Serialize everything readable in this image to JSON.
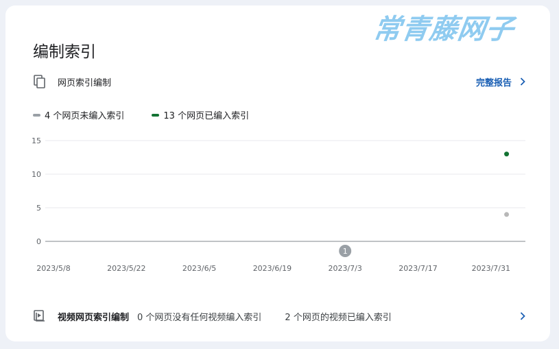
{
  "watermark": "常青藤网子",
  "card": {
    "title": "编制索引"
  },
  "pages_row": {
    "icon": "copy-pages-icon",
    "label": "网页索引编制",
    "report_label": "完整报告"
  },
  "legend": [
    {
      "label": "4 个网页未编入索引",
      "color": "#9aa0a6"
    },
    {
      "label": "13 个网页已编入索引",
      "color": "#137333"
    }
  ],
  "chart_data": {
    "type": "scatter",
    "x_ticks": [
      "2023/5/8",
      "2023/5/22",
      "2023/6/5",
      "2023/6/19",
      "2023/7/3",
      "2023/7/17",
      "2023/7/31"
    ],
    "y_ticks": [
      0,
      5,
      10,
      15
    ],
    "ylim": [
      0,
      15
    ],
    "grid": true,
    "series": [
      {
        "name": "4 个网页未编入索引",
        "color": "#b8b8b8",
        "points": [
          {
            "x": "2023/8/3",
            "y": 4
          }
        ]
      },
      {
        "name": "13 个网页已编入索引",
        "color": "#137333",
        "points": [
          {
            "x": "2023/8/3",
            "y": 13
          }
        ]
      }
    ],
    "annotations": [
      {
        "x": "2023/7/3",
        "label": "1",
        "color": "#9aa0a6"
      }
    ]
  },
  "video_row": {
    "icon": "video-play-icon",
    "label": "视频网页索引编制",
    "stat_1": "0 个网页没有任何视频编入索引",
    "stat_2": "2 个网页的视频已编入索引"
  }
}
